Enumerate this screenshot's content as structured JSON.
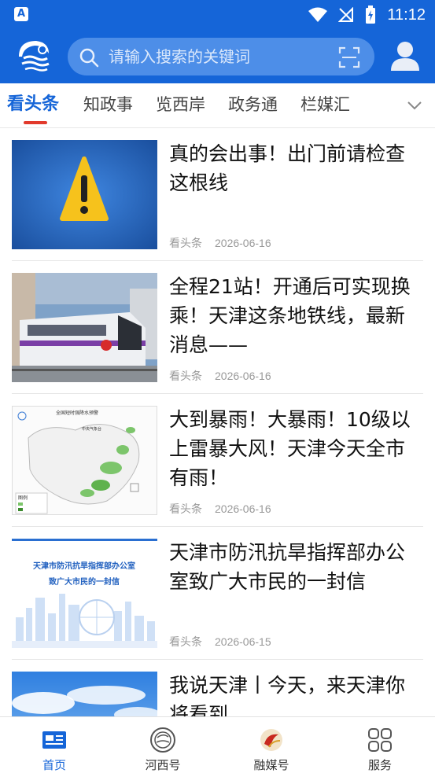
{
  "status_bar": {
    "time": "11:12"
  },
  "header": {
    "search_placeholder": "请输入搜索的关键词"
  },
  "tabs": [
    {
      "label": "看头条",
      "active": true
    },
    {
      "label": "知政事",
      "active": false
    },
    {
      "label": "览西岸",
      "active": false
    },
    {
      "label": "政务通",
      "active": false
    },
    {
      "label": "栏媒汇",
      "active": false
    }
  ],
  "news": [
    {
      "title": "真的会出事！出门前请检查这根线",
      "source": "看头条",
      "date": "2026-06-16",
      "thumb": "warning-sign"
    },
    {
      "title": "全程21站！开通后可实现换乘！天津这条地铁线，最新消息——",
      "source": "看头条",
      "date": "2026-06-16",
      "thumb": "metro-train"
    },
    {
      "title": "大到暴雨！大暴雨！10级以上雷暴大风！天津今天全市有雨！",
      "source": "看头条",
      "date": "2026-06-16",
      "thumb": "rain-map",
      "thumb_text": {
        "title": "全国短时强降水预警",
        "subtitle": "中央气象台",
        "legend": "图例"
      }
    },
    {
      "title": "天津市防汛抗旱指挥部办公室致广大市民的一封信",
      "source": "看头条",
      "date": "2026-06-15",
      "thumb": "letter-skyline",
      "thumb_text": {
        "line1": "天津市防汛抗旱指挥部办公室",
        "line2": "致广大市民的一封信"
      }
    },
    {
      "title": "我说天津丨今天，来天津你将看到",
      "source": "",
      "date": "",
      "thumb": "sky-clouds"
    }
  ],
  "bottom_nav": [
    {
      "label": "首页",
      "icon": "home-news-icon",
      "active": true
    },
    {
      "label": "河西号",
      "icon": "hexi-circle-icon",
      "active": false
    },
    {
      "label": "融媒号",
      "icon": "media-logo-icon",
      "active": false
    },
    {
      "label": "服务",
      "icon": "grid-apps-icon",
      "active": false
    }
  ],
  "colors": {
    "brand_blue": "#1565d8",
    "tab_indicator": "#e23a2c",
    "meta_gray": "#999999"
  }
}
